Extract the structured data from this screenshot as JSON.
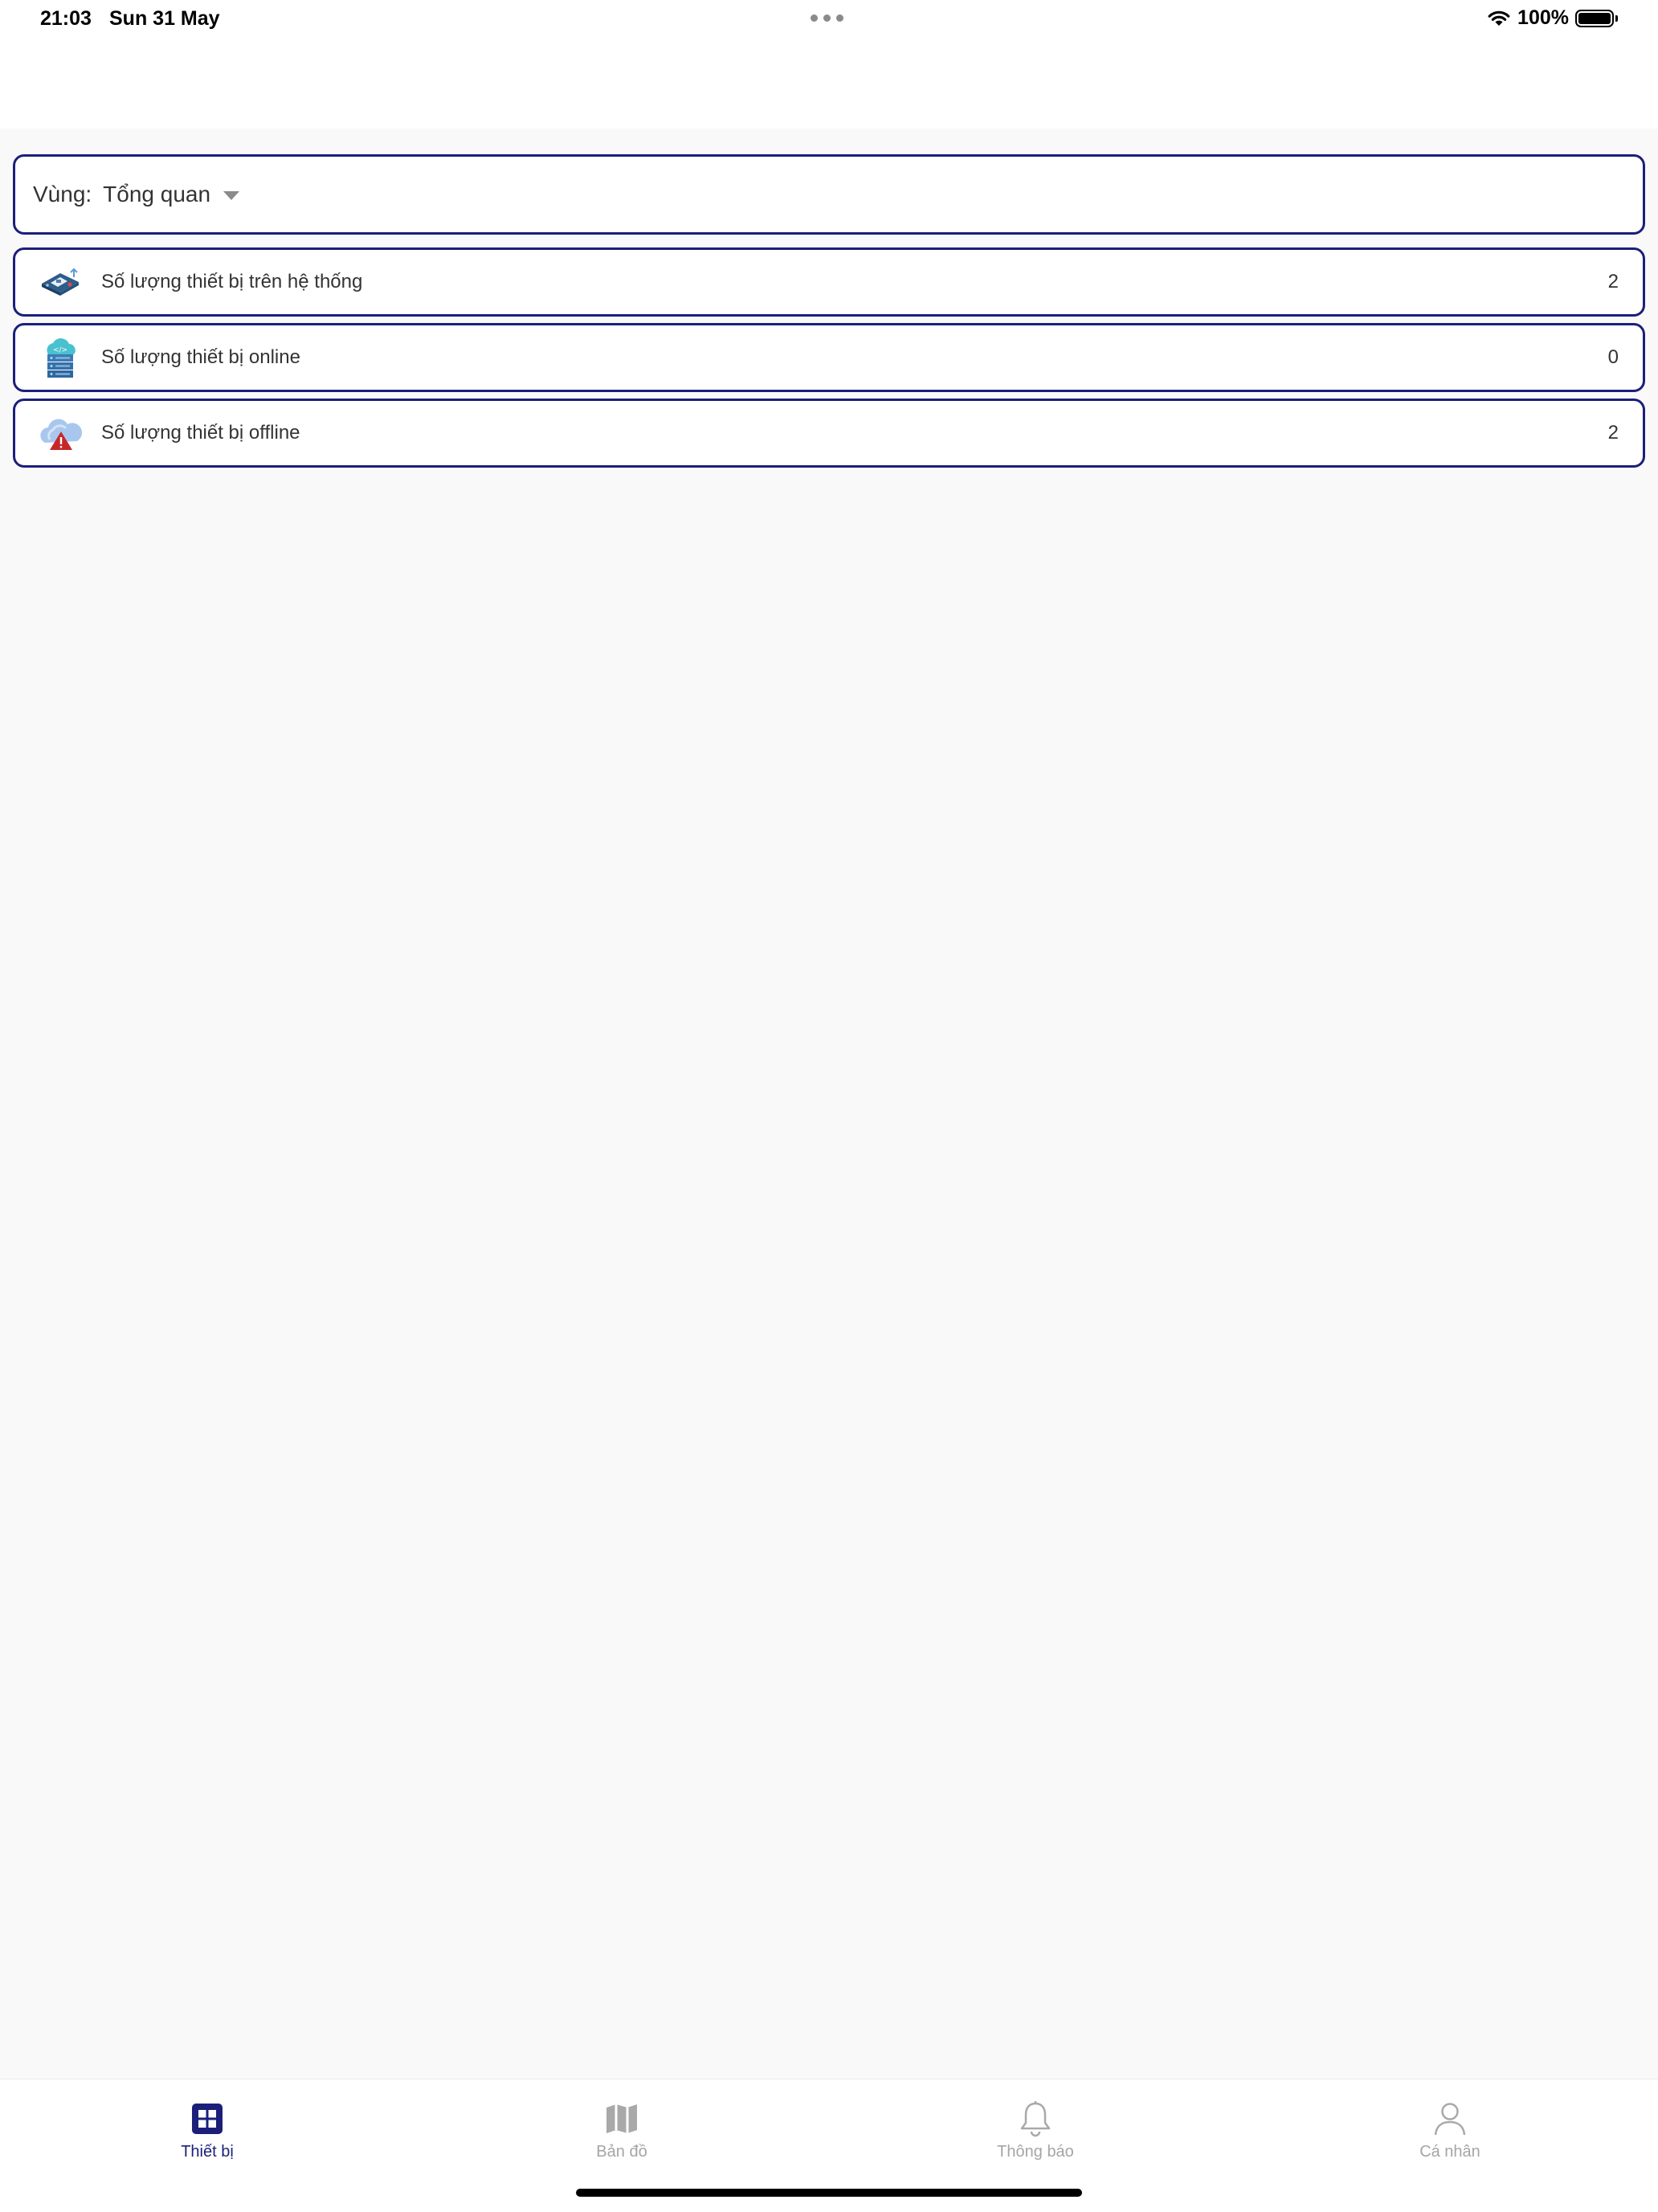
{
  "status_bar": {
    "time": "21:03",
    "date": "Sun 31 May",
    "battery": "100%",
    "icons": [
      "wifi-icon",
      "battery-icon"
    ]
  },
  "region": {
    "label": "Vùng:",
    "value": "Tổng quan"
  },
  "stats": [
    {
      "label": "Số lượng thiết bị trên hệ thống",
      "value": "2",
      "icon": "device-board-icon"
    },
    {
      "label": "Số lượng thiết bị online",
      "value": "0",
      "icon": "cloud-server-icon"
    },
    {
      "label": "Số lượng thiết bị offline",
      "value": "2",
      "icon": "cloud-warning-icon"
    }
  ],
  "tabs": [
    {
      "label": "Thiết bị",
      "icon": "grid-icon",
      "active": true
    },
    {
      "label": "Bản đồ",
      "icon": "map-icon",
      "active": false
    },
    {
      "label": "Thông báo",
      "icon": "bell-icon",
      "active": false
    },
    {
      "label": "Cá nhân",
      "icon": "person-icon",
      "active": false
    }
  ],
  "colors": {
    "accent": "#1b1f7a",
    "inactive_tab": "#a5a5a5",
    "background": "#f9f9f9"
  }
}
